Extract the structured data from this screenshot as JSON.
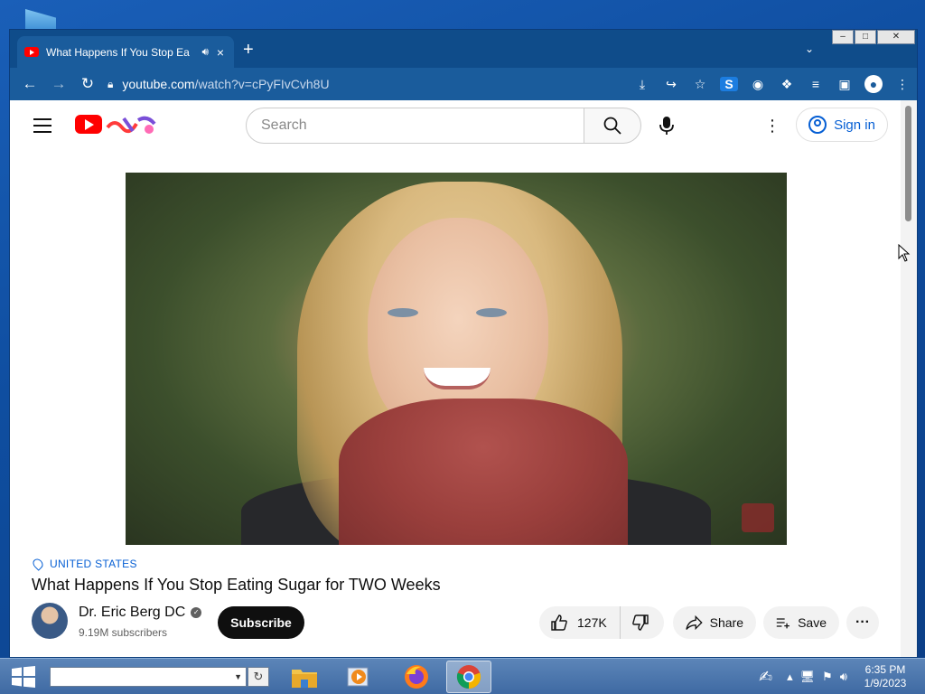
{
  "browser": {
    "tab_title": "What Happens If You Stop Ea",
    "tab_audio_icon": "speaker-icon",
    "new_tab_label": "+",
    "url_host": "youtube.com",
    "url_path": "/watch?v=cPyFIvCvh8U",
    "window_controls": {
      "minimize": "–",
      "maximize": "□",
      "close": "✕"
    }
  },
  "youtube": {
    "search_placeholder": "Search",
    "sign_in_label": "Sign in",
    "video": {
      "location": "UNITED STATES",
      "title": "What Happens If You Stop Eating Sugar for TWO Weeks",
      "channel_name": "Dr. Eric Berg DC",
      "subscribers": "9.19M subscribers",
      "subscribe_label": "Subscribe",
      "likes": "127K",
      "share_label": "Share",
      "save_label": "Save",
      "more_label": "···"
    }
  },
  "taskbar": {
    "address_value": "",
    "go_label": "↻",
    "clock_time": "6:35 PM",
    "clock_date": "1/9/2023",
    "apps": [
      "file-explorer-icon",
      "media-player-icon",
      "firefox-icon",
      "chrome-icon"
    ]
  },
  "colors": {
    "chrome_frame": "#0f4c8a",
    "chrome_toolbar": "#1a5c9c",
    "youtube_red": "#ff0000",
    "link_blue": "#065fd4"
  }
}
